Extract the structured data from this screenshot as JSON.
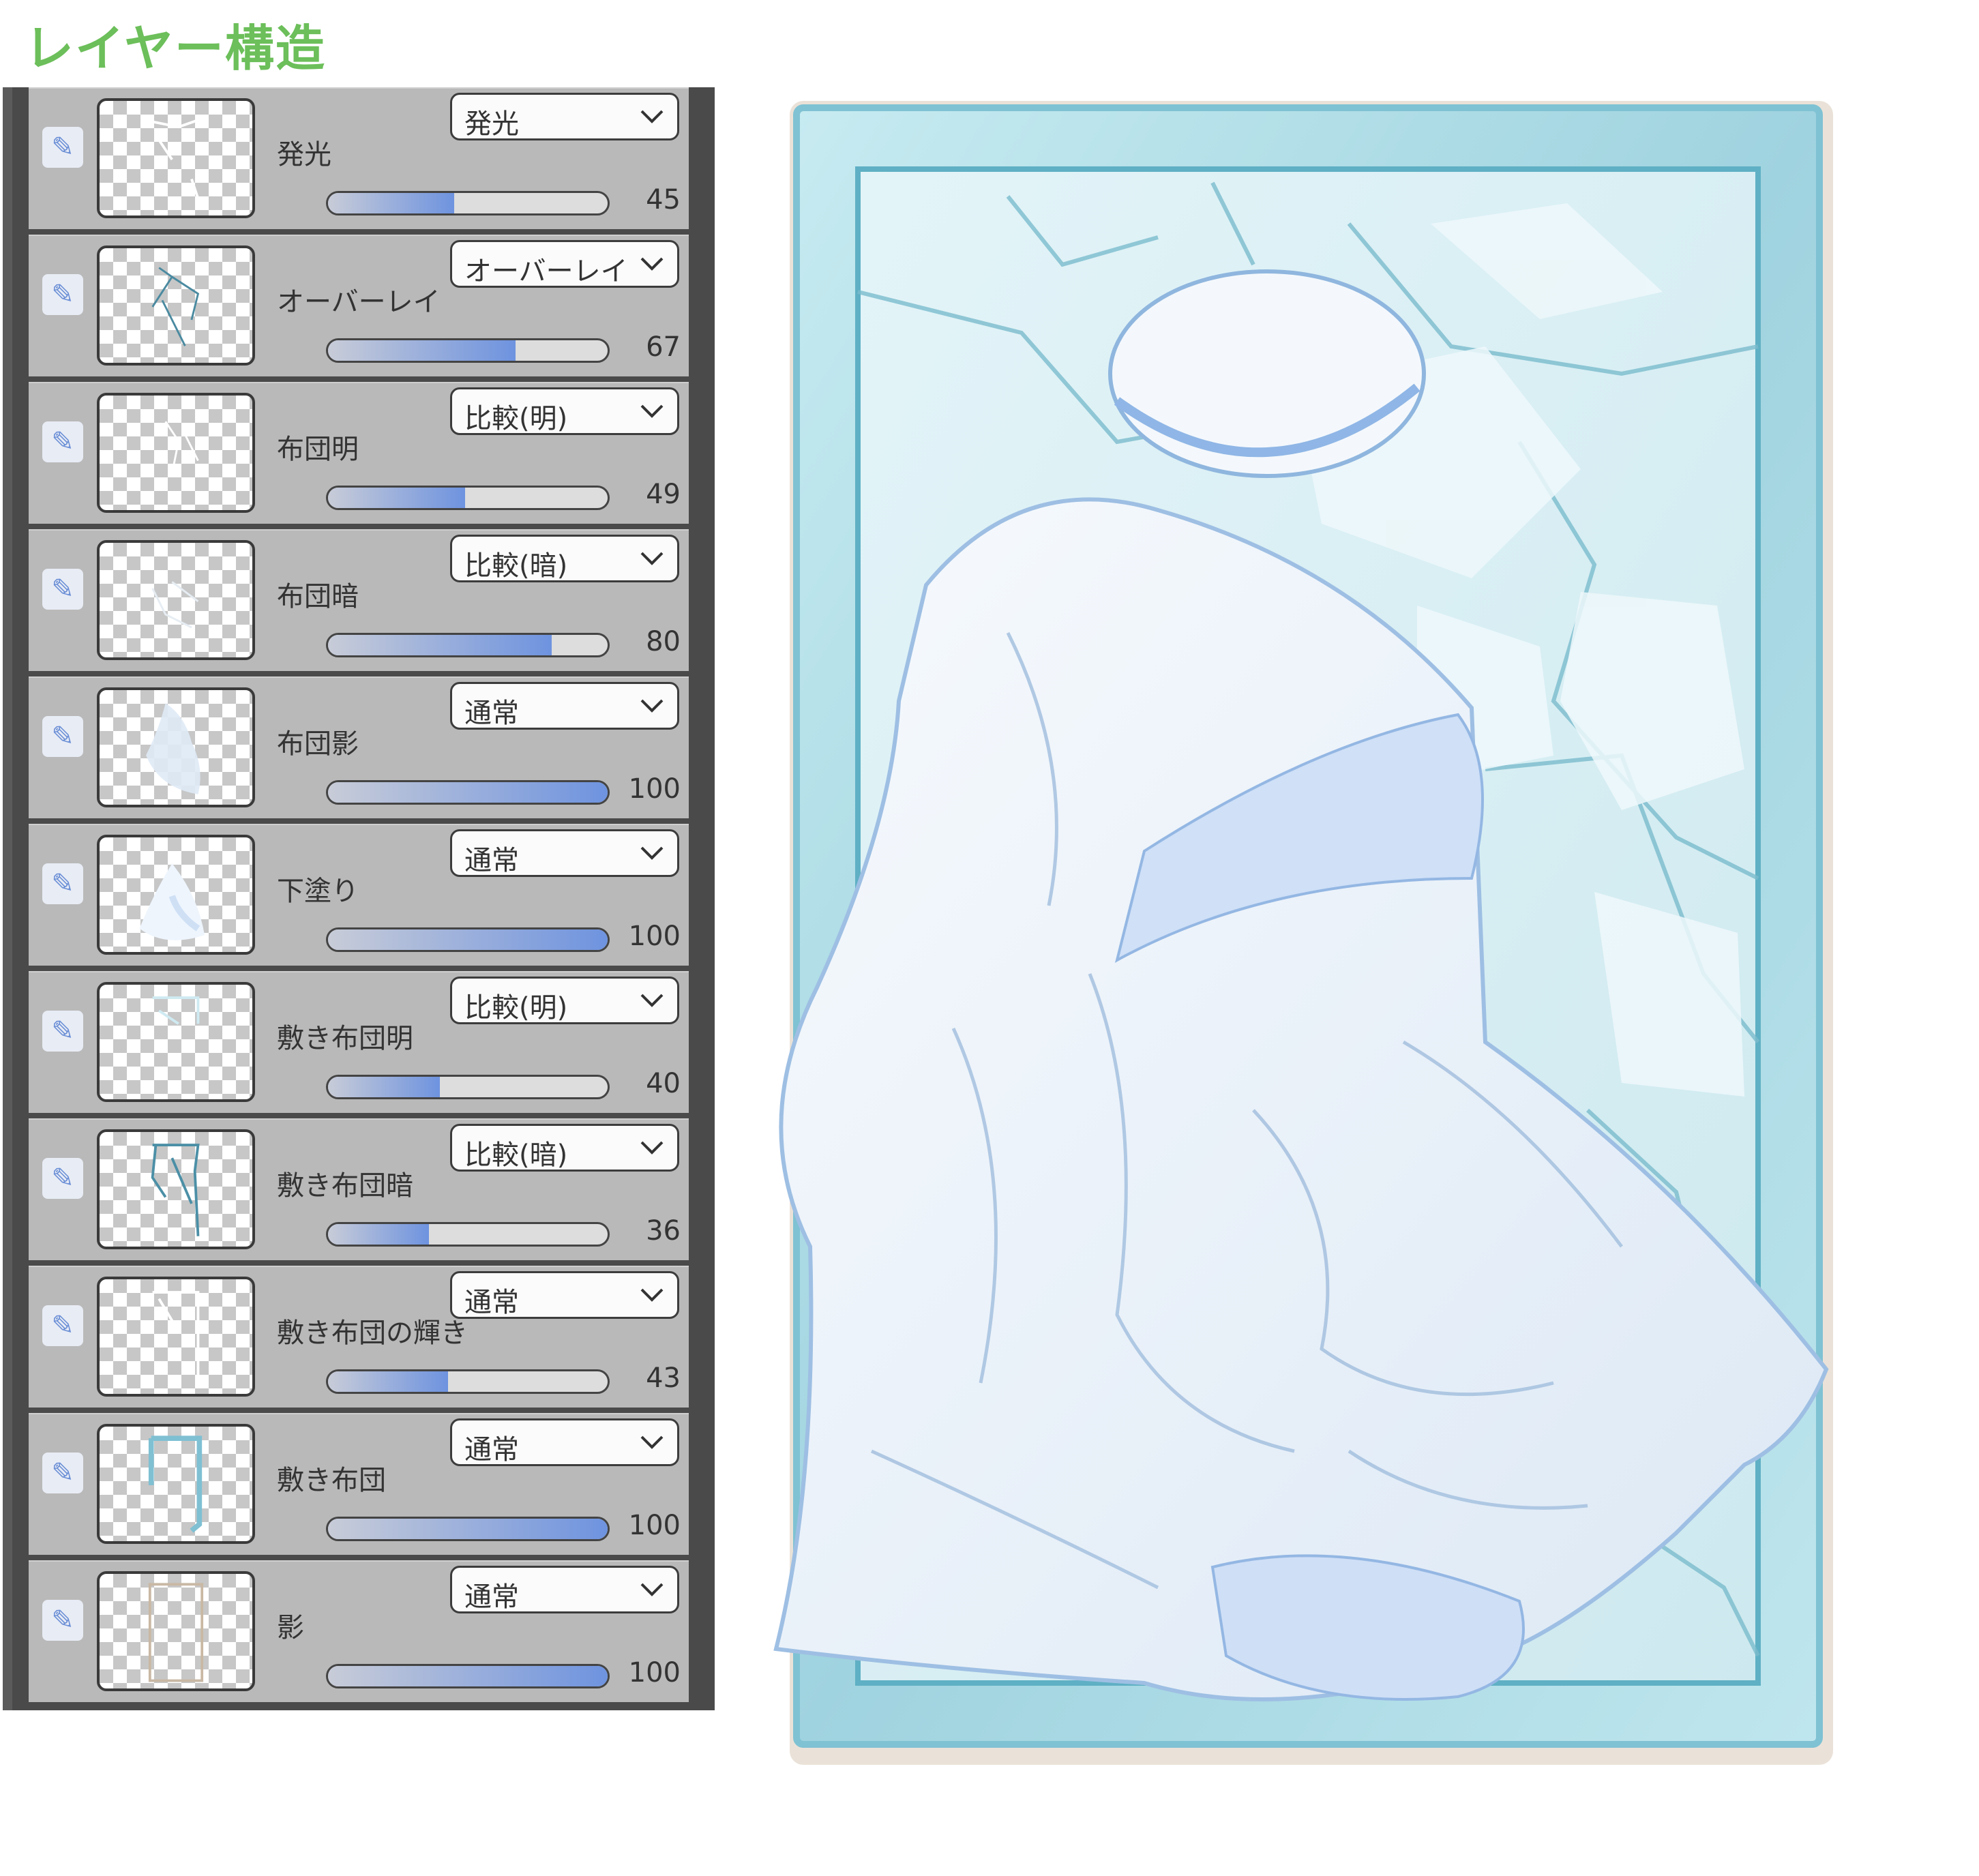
{
  "page_title": "レイヤー構造",
  "layers": [
    {
      "name": "発光",
      "blend_mode": "発光",
      "opacity": 45
    },
    {
      "name": "オーバーレイ",
      "blend_mode": "オーバーレイ",
      "opacity": 67
    },
    {
      "name": "布団明",
      "blend_mode": "比較(明)",
      "opacity": 49
    },
    {
      "name": "布団暗",
      "blend_mode": "比較(暗)",
      "opacity": 80
    },
    {
      "name": "布団影",
      "blend_mode": "通常",
      "opacity": 100
    },
    {
      "name": "下塗り",
      "blend_mode": "通常",
      "opacity": 100
    },
    {
      "name": "敷き布団明",
      "blend_mode": "比較(明)",
      "opacity": 40
    },
    {
      "name": "敷き布団暗",
      "blend_mode": "比較(暗)",
      "opacity": 36
    },
    {
      "name": "敷き布団の輝き",
      "blend_mode": "通常",
      "opacity": 43
    },
    {
      "name": "敷き布団",
      "blend_mode": "通常",
      "opacity": 100
    },
    {
      "name": "影",
      "blend_mode": "通常",
      "opacity": 100
    }
  ],
  "icons": {
    "visibility": "pen-icon",
    "dropdown": "chevron-down-icon"
  },
  "colors": {
    "title": "#6cbf5a",
    "slider_fill": "#6e93df",
    "ice": "#a9d9e4",
    "duvet": "#eef4fb"
  }
}
